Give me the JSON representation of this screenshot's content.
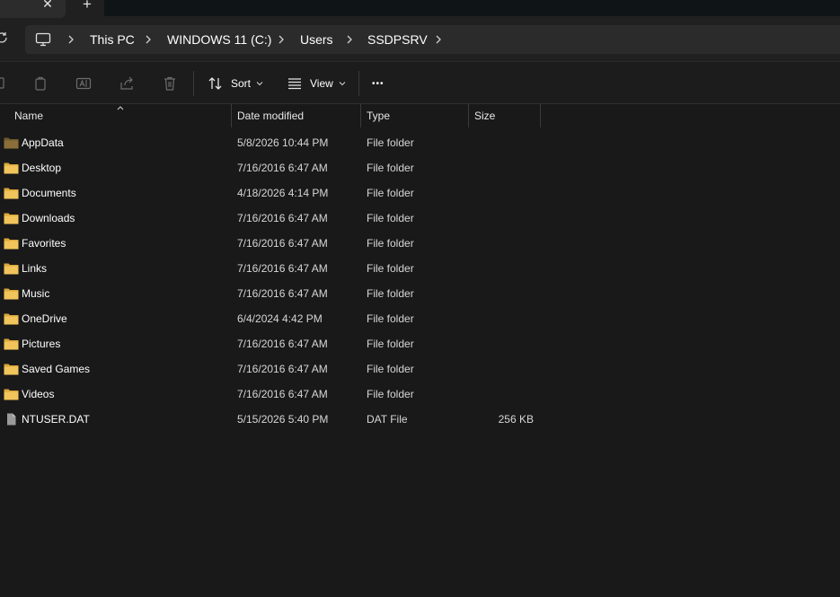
{
  "window": {
    "tab_close_glyph": "✕",
    "tab_new_glyph": "+"
  },
  "address": {
    "crumbs": [
      "This PC",
      "WINDOWS 11 (C:)",
      "Users",
      "SSDPSRV"
    ]
  },
  "commandbar": {
    "sort_label": "Sort",
    "view_label": "View",
    "more_glyph": "•••"
  },
  "columns": {
    "name": "Name",
    "date": "Date modified",
    "type": "Type",
    "size": "Size"
  },
  "files": [
    {
      "name": "AppData",
      "date": "5/8/2026 10:44 PM",
      "type": "File folder",
      "size": "",
      "icon": "folder-hidden-icon"
    },
    {
      "name": "Desktop",
      "date": "7/16/2016 6:47 AM",
      "type": "File folder",
      "size": "",
      "icon": "folder-icon"
    },
    {
      "name": "Documents",
      "date": "4/18/2026 4:14 PM",
      "type": "File folder",
      "size": "",
      "icon": "folder-icon"
    },
    {
      "name": "Downloads",
      "date": "7/16/2016 6:47 AM",
      "type": "File folder",
      "size": "",
      "icon": "folder-icon"
    },
    {
      "name": "Favorites",
      "date": "7/16/2016 6:47 AM",
      "type": "File folder",
      "size": "",
      "icon": "folder-icon"
    },
    {
      "name": "Links",
      "date": "7/16/2016 6:47 AM",
      "type": "File folder",
      "size": "",
      "icon": "folder-icon"
    },
    {
      "name": "Music",
      "date": "7/16/2016 6:47 AM",
      "type": "File folder",
      "size": "",
      "icon": "folder-icon"
    },
    {
      "name": "OneDrive",
      "date": "6/4/2024 4:42 PM",
      "type": "File folder",
      "size": "",
      "icon": "folder-icon"
    },
    {
      "name": "Pictures",
      "date": "7/16/2016 6:47 AM",
      "type": "File folder",
      "size": "",
      "icon": "folder-icon"
    },
    {
      "name": "Saved Games",
      "date": "7/16/2016 6:47 AM",
      "type": "File folder",
      "size": "",
      "icon": "folder-icon"
    },
    {
      "name": "Videos",
      "date": "7/16/2016 6:47 AM",
      "type": "File folder",
      "size": "",
      "icon": "folder-icon"
    },
    {
      "name": "NTUSER.DAT",
      "date": "5/15/2026 5:40 PM",
      "type": "DAT File",
      "size": "256 KB",
      "icon": "file-icon"
    }
  ],
  "colors": {
    "folder": "#f2c55c",
    "folder_shade": "#dca93a",
    "folder_hidden": "#8a6f3a",
    "file": "#9a9a9a"
  }
}
